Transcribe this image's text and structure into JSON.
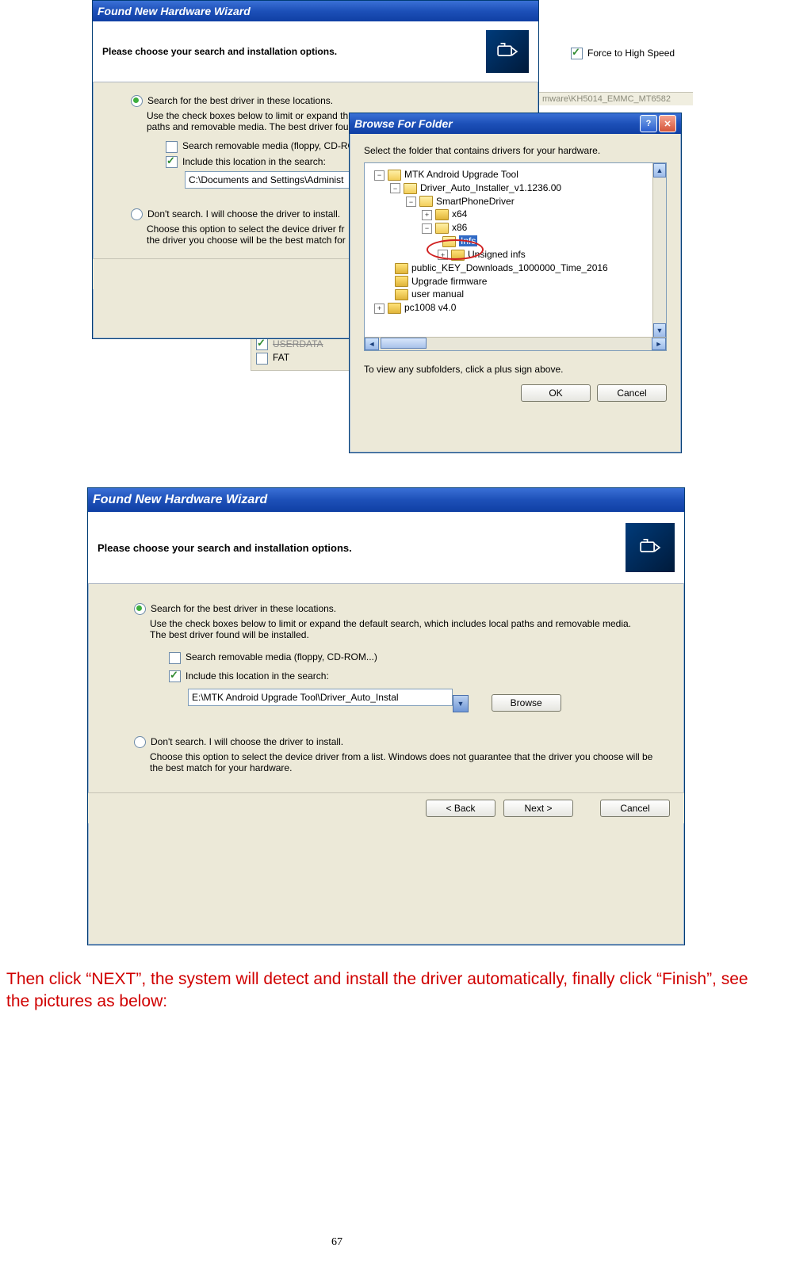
{
  "bg": {
    "force_high_speed_label": "Force to High Speed",
    "pathbar_text": "mware\\KH5014_EMMC_MT6582",
    "userdata_label": "USERDATA",
    "fat_label": "FAT"
  },
  "w1": {
    "title": "Found New Hardware Wizard",
    "heading": "Please choose your search and installation options.",
    "radio_search": "Search for the best driver in these locations.",
    "search_hint": "Use the check boxes below to limit or expand the default search, which includes local paths and removable media. The best driver found will be installed.",
    "search_hint_clipped": "Use the check boxes below to limit or expand th\npaths and removable media. The best driver fou",
    "check_removable": "Search removable media (floppy, CD-RO",
    "check_include": "Include this location in the search:",
    "path_value": "C:\\Documents and Settings\\Administ",
    "radio_dontsearch": "Don't search. I will choose the driver to install.",
    "dontsearch_hint_clipped": "Choose this option to select the device driver fr\nthe driver you choose will be the best match for"
  },
  "browse": {
    "title": "Browse For Folder",
    "prompt": "Select the folder that contains drivers for your hardware.",
    "footer_hint": "To view any subfolders, click a plus sign above.",
    "ok": "OK",
    "cancel": "Cancel",
    "tree": {
      "n0": "MTK Android Upgrade Tool",
      "n1": "Driver_Auto_Installer_v1.1236.00",
      "n2": "SmartPhoneDriver",
      "n3": "x64",
      "n4": "x86",
      "n5": "Infs",
      "n6": "Unsigned infs",
      "n7": "public_KEY_Downloads_1000000_Time_2016",
      "n8": "Upgrade firmware",
      "n9": "user manual",
      "n10": "pc1008 v4.0"
    }
  },
  "w2": {
    "title": "Found New Hardware Wizard",
    "heading": "Please choose your search and installation options.",
    "radio_search": "Search for the best driver in these locations.",
    "search_hint": "Use the check boxes below to limit or expand the default search, which includes local paths and removable media. The best driver found will be installed.",
    "check_removable": "Search removable media (floppy, CD-ROM...)",
    "check_include": "Include this location in the search:",
    "path_value": "E:\\MTK Android Upgrade Tool\\Driver_Auto_Instal",
    "browse_btn": "Browse",
    "radio_dontsearch": "Don't search. I will choose the driver to install.",
    "dontsearch_hint": "Choose this option to select the device driver from a list.  Windows does not guarantee that the driver you choose will be the best match for your hardware.",
    "back": "< Back",
    "next": "Next >",
    "cancel": "Cancel"
  },
  "instruction_text": "Then click “NEXT”, the system will detect and install the driver automatically, finally click “Finish”, see the pictures as below:",
  "page_number": "67"
}
